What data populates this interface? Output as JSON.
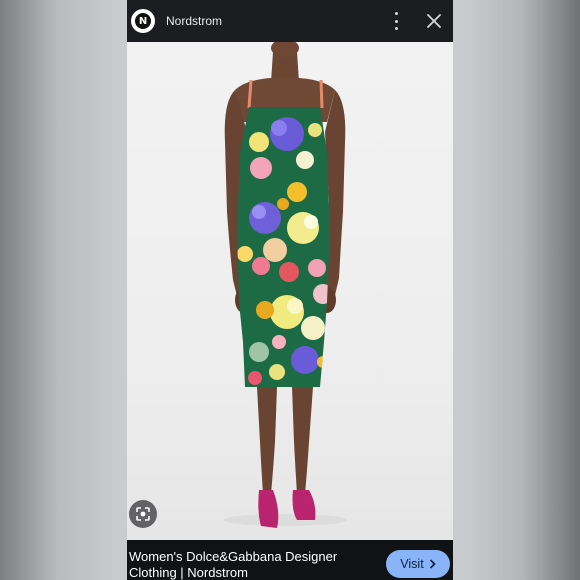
{
  "header": {
    "site_name": "Nordstrom",
    "logo_letter": "N",
    "more_icon": "more-vert-icon",
    "close_icon": "close-icon"
  },
  "image": {
    "subject": "model wearing floral print midi dress",
    "lens_icon": "google-lens-icon"
  },
  "caption": {
    "title": "Women's Dolce&Gabbana Designer Clothing | Nordstrom",
    "visit_label": "Visit",
    "visit_icon": "chevron-right-icon"
  },
  "colors": {
    "topbar": "#1c1d20",
    "visit_button": "#8ab4f8",
    "dress_base": "#1d6b45",
    "shoes": "#b8246e"
  }
}
